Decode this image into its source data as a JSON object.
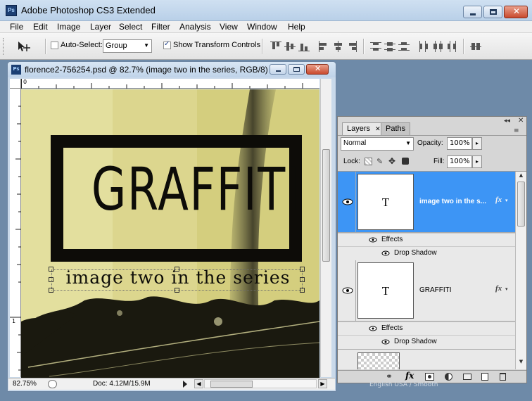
{
  "app": {
    "title": "Adobe Photoshop CS3 Extended",
    "logo": "Ps"
  },
  "menu": [
    "File",
    "Edit",
    "Image",
    "Layer",
    "Select",
    "Filter",
    "Analysis",
    "View",
    "Window",
    "Help"
  ],
  "options": {
    "auto_select_label": "Auto-Select:",
    "auto_select_checked": false,
    "auto_select_value": "Group",
    "show_transform_label": "Show Transform Controls",
    "show_transform_checked": true
  },
  "document": {
    "title": "florence2-756254.psd @ 82.7% (image two in the series, RGB/8)",
    "ruler_h_zero": "0",
    "ruler_v_one": "1",
    "zoom": "82.75%",
    "doc_size": "Doc: 4.12M/15.9M"
  },
  "artwork": {
    "headline": "GRAFFITI",
    "subline": "image two in the series"
  },
  "layers_panel": {
    "tabs": [
      "Layers",
      "Paths"
    ],
    "blend_mode": "Normal",
    "opacity_label": "Opacity:",
    "opacity": "100%",
    "lock_label": "Lock:",
    "fill_label": "Fill:",
    "fill": "100%",
    "layers": [
      {
        "name": "image two in the s...",
        "thumb": "T",
        "selected": true,
        "effects_label": "Effects",
        "effect": "Drop Shadow"
      },
      {
        "name": "GRAFFITI",
        "thumb": "T",
        "selected": false,
        "effects_label": "Effects",
        "effect": "Drop Shadow"
      }
    ],
    "footer_text": "English USA / Smooth"
  },
  "colors": {
    "selected_layer": "#3d95f5",
    "titlebar": "#c8dbef"
  }
}
